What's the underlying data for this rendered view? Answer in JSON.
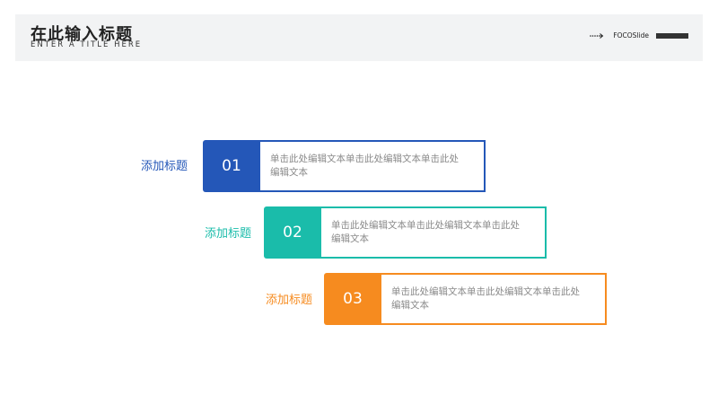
{
  "header": {
    "title": "在此输入标题",
    "subtitle": "ENTER A TITLE HERE",
    "brand": "FOCOSlide"
  },
  "items": [
    {
      "number": "01",
      "heading": "添加标题",
      "text": "单击此处编辑文本单击此处编辑文本单击此处编辑文本",
      "color": "#2457b8"
    },
    {
      "number": "02",
      "heading": "添加标题",
      "text": "单击此处编辑文本单击此处编辑文本单击此处编辑文本",
      "color": "#1abcaa"
    },
    {
      "number": "03",
      "heading": "添加标题",
      "text": "单击此处编辑文本单击此处编辑文本单击此处编辑文本",
      "color": "#f68b1f"
    }
  ]
}
